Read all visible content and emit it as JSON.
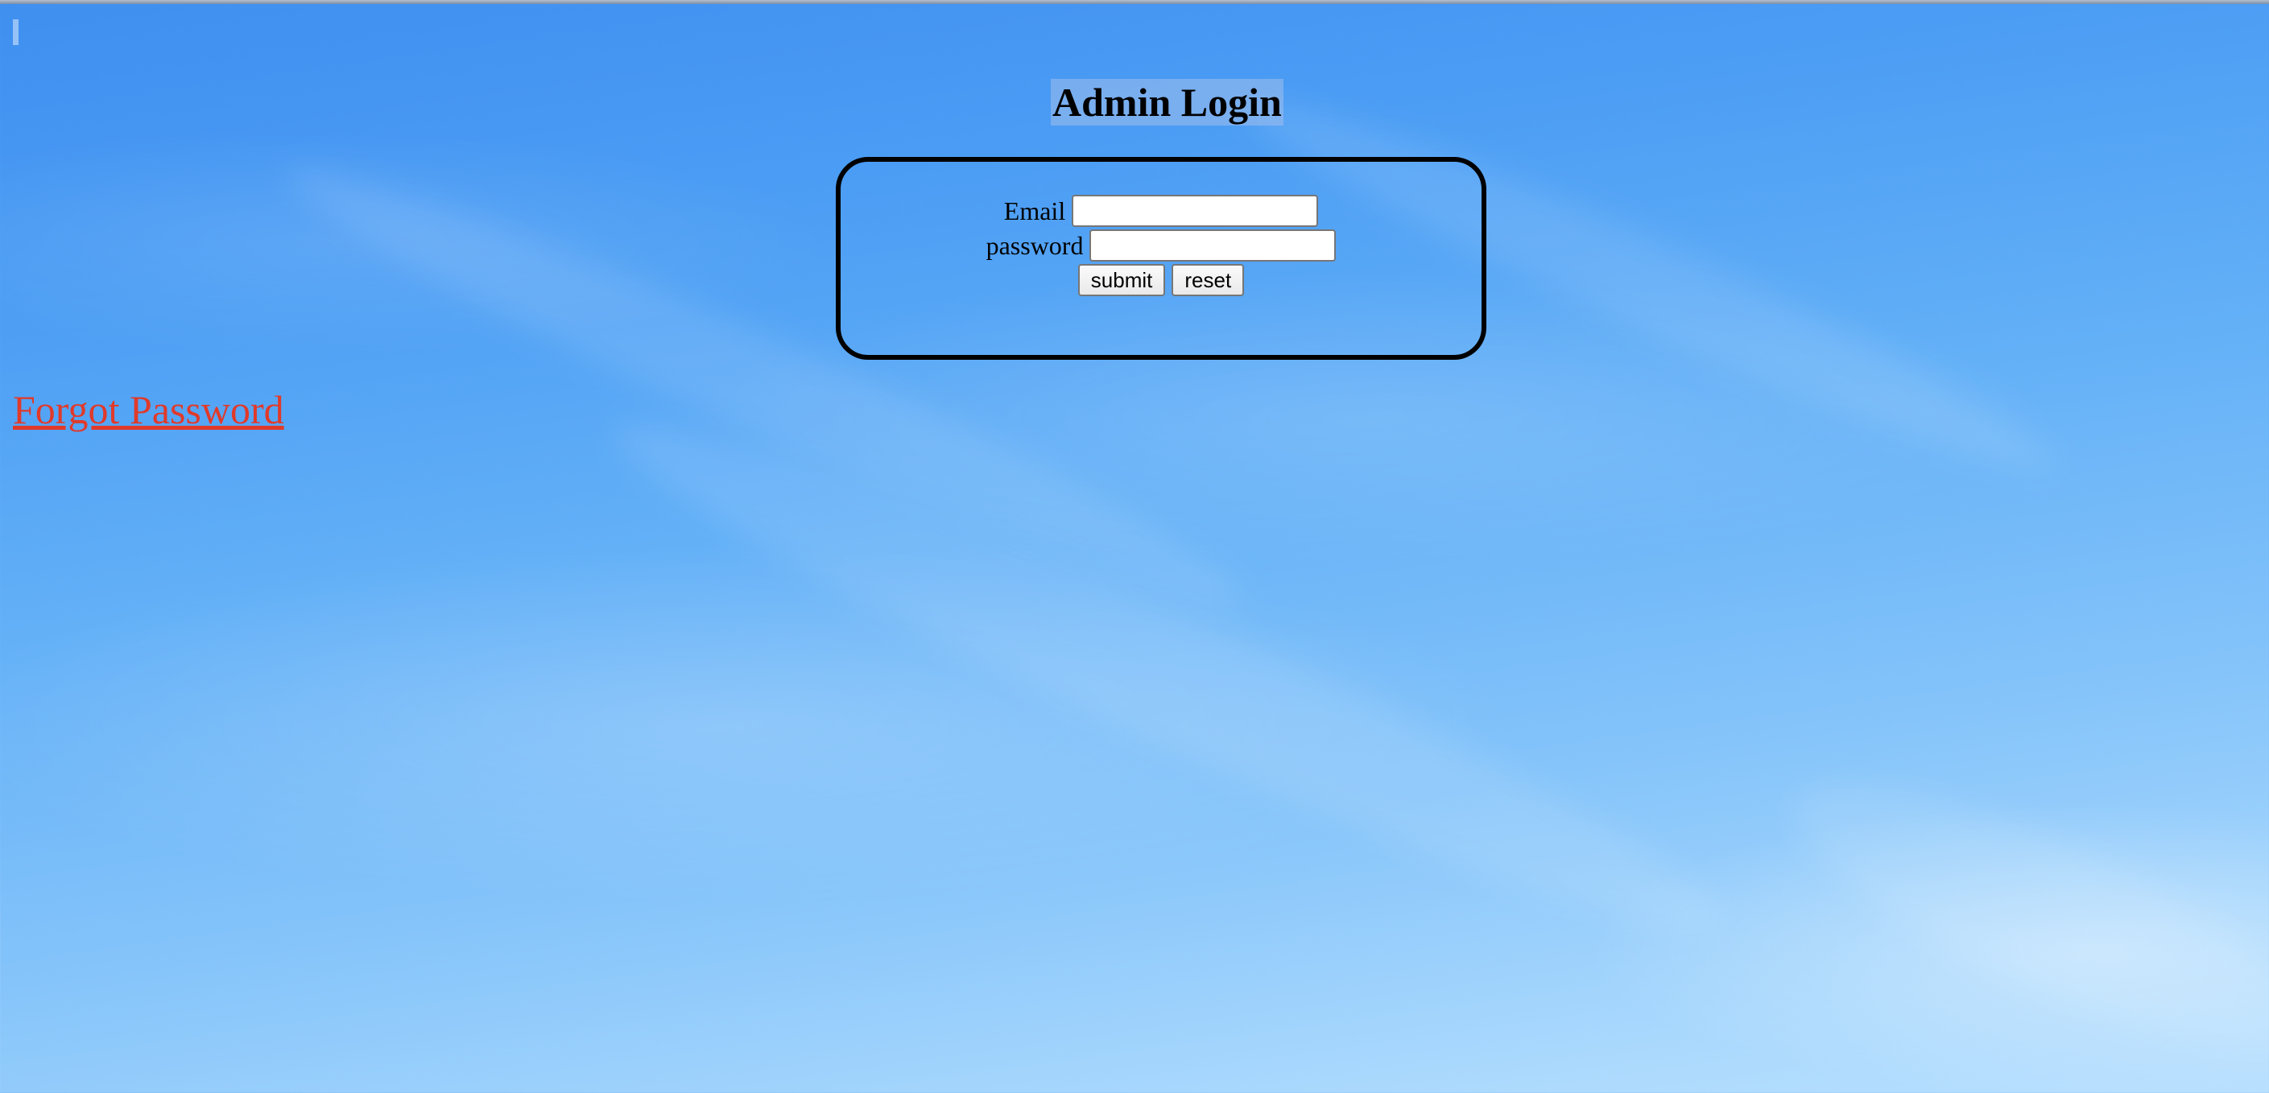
{
  "page": {
    "title": "Admin Login"
  },
  "login_form": {
    "email_label": "Email",
    "email_value": "",
    "password_label": "password",
    "password_value": "",
    "submit_label": "submit",
    "reset_label": "reset"
  },
  "links": {
    "forgot_password": "Forgot Password"
  },
  "colors": {
    "link": "#e03a2a",
    "box_border": "#000000",
    "sky_top": "#3f8ff0",
    "sky_bottom": "#b9e0fe"
  }
}
